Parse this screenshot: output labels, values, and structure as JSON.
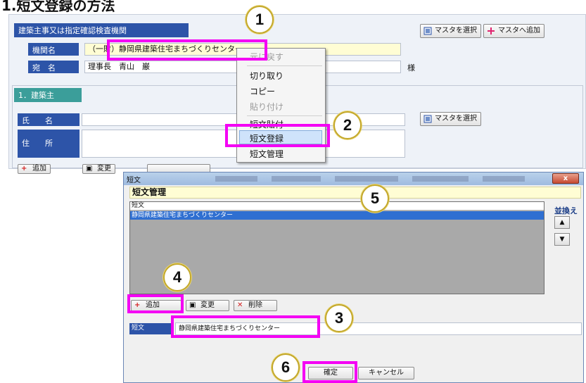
{
  "heading": "1.短文登録の方法",
  "form": {
    "section_title": "建築主事又は指定確認検査機関",
    "org_label": "機関名",
    "org_value": "（一財）静岡県建築住宅まちづくりセンター",
    "addressee_label": "宛　名",
    "addressee_value": "理事長　青山　巌",
    "honorific": "様",
    "select_master_btn": "マスタを選択",
    "add_master_btn": "マスタへ追加",
    "owner_section": "1．建築主",
    "name_label": "氏　　名",
    "address_label": "住　　所",
    "owner_select_master_btn": "マスタを選択",
    "bottom_add_btn": "追加",
    "bottom_change_btn": "変更"
  },
  "context_menu": {
    "items": [
      "元に戻す",
      "切り取り",
      "コピー",
      "貼り付け",
      "短文貼付",
      "短文登録",
      "短文管理"
    ]
  },
  "dialog": {
    "title": "短文",
    "close_label": "x",
    "heading": "短文管理",
    "list_header": "短文",
    "list_item": "静岡県建築住宅まちづくりセンター",
    "sort_label": "並換え",
    "up_label": "▲",
    "down_label": "▼",
    "add_btn": "追加",
    "change_btn": "変更",
    "delete_btn": "削除",
    "short_label": "短文",
    "short_value": "静岡県建築住宅まちづくりセンター",
    "ok_btn": "確定",
    "cancel_btn": "キャンセル"
  },
  "badges": [
    "1",
    "2",
    "3",
    "4",
    "5",
    "6"
  ],
  "colors": {
    "accent": "#f400f4",
    "header_blue": "#2d54a8",
    "highlight_yellow": "#fffdd4"
  }
}
